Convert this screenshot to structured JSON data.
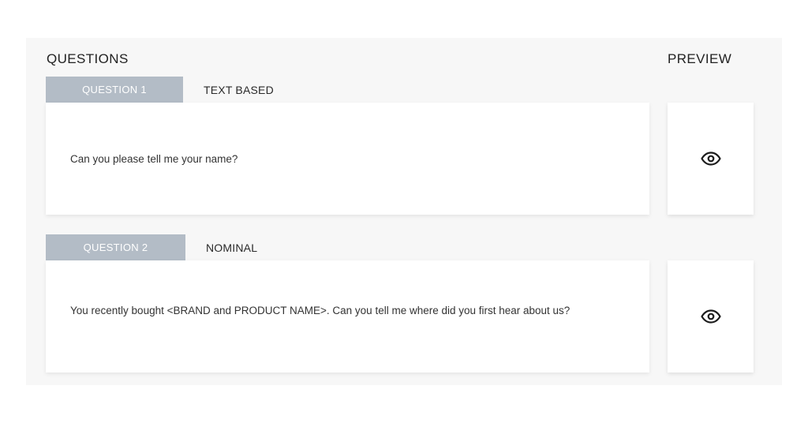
{
  "headings": {
    "questions": "QUESTIONS",
    "preview": "PREVIEW"
  },
  "questions": [
    {
      "tab_label": "QUESTION 1",
      "type": "TEXT BASED",
      "text": "Can you please tell me your name?",
      "preview_icon": "eye-icon"
    },
    {
      "tab_label": "QUESTION 2",
      "type": "NOMINAL",
      "text": "You recently bought <BRAND and PRODUCT NAME>. Can you tell me where did you first hear about us?",
      "preview_icon": "eye-icon"
    }
  ],
  "colors": {
    "tab_background": "#b3bcc6",
    "panel_background": "#f7f7f7"
  }
}
